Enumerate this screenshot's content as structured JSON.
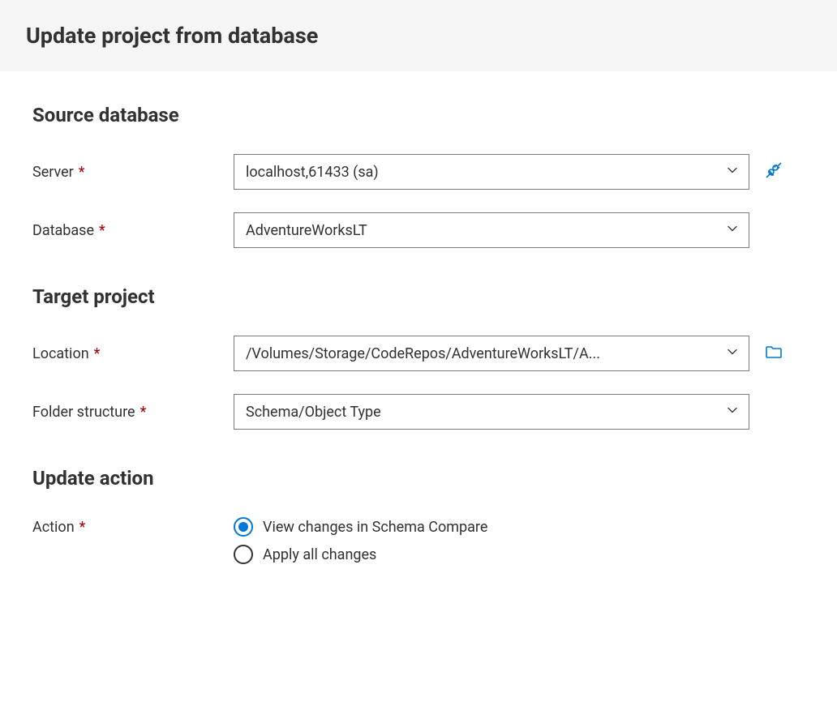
{
  "header": {
    "title": "Update project from database"
  },
  "source_database": {
    "heading": "Source database",
    "server_label": "Server",
    "server_value": "localhost,61433 (sa)",
    "database_label": "Database",
    "database_value": "AdventureWorksLT"
  },
  "target_project": {
    "heading": "Target project",
    "location_label": "Location",
    "location_value": "/Volumes/Storage/CodeRepos/AdventureWorksLT/A...",
    "folder_structure_label": "Folder structure",
    "folder_structure_value": "Schema/Object Type"
  },
  "update_action": {
    "heading": "Update action",
    "action_label": "Action",
    "options": {
      "view_changes": "View changes in Schema Compare",
      "apply_all": "Apply all changes"
    }
  },
  "colors": {
    "accent": "#0078d4",
    "required": "#a80000"
  }
}
